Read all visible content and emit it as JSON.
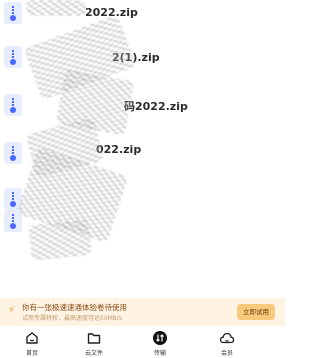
{
  "files": [
    {
      "name": "2022.zip"
    },
    {
      "name": "2(1).zip"
    },
    {
      "name": "码2022.zip"
    },
    {
      "name": "022.zip"
    },
    {
      "name": ""
    },
    {
      "name": ""
    }
  ],
  "promo": {
    "title": "你有一张极速速通体验卷待使用",
    "subtitle": "试用专属特权，最高速度可达50MB/s",
    "button": "立即试用"
  },
  "tabs": [
    {
      "label": "首页",
      "icon": "home-icon"
    },
    {
      "label": "云文件",
      "icon": "folder-icon"
    },
    {
      "label": "传输",
      "icon": "transfer-icon"
    },
    {
      "label": "会员",
      "icon": "cloud-member-icon"
    }
  ],
  "colors": {
    "accent": "#4a67ff",
    "promo_bg": "#fff3e3",
    "promo_btn": "#f6c97b"
  }
}
